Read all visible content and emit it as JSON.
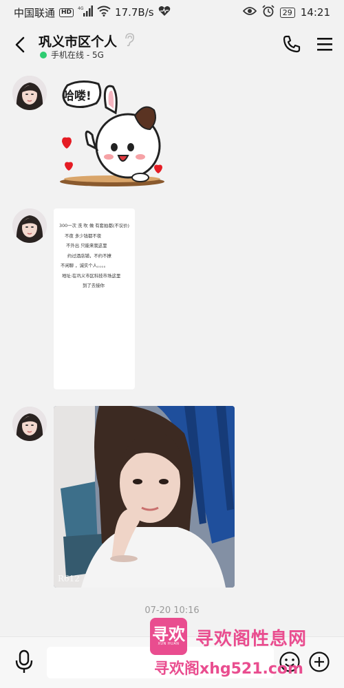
{
  "status_bar": {
    "carrier": "中国联通",
    "hd_badge": "HD",
    "network_type": "4G",
    "speed": "17.7B/s",
    "battery": "29",
    "time": "14:21"
  },
  "header": {
    "title": "巩义市区个人",
    "status": "手机在线 - 5G"
  },
  "messages": {
    "sticker_text": "哈喽!",
    "note_lines": [
      "300一次  洗  吹  做   有套拍都(不议价)",
      "不夜       多少钱都不夜",
      "不外出      只能来我这里",
      "约过酒店铺，不约不撩",
      "不闲聊  ，诚实个人。。。。",
      "地址:在巩义市区科技市场这里",
      "到了去接你"
    ],
    "photo_mark": "R612",
    "timestamp": "07-20 10:16"
  },
  "watermark": {
    "logo_char": "寻欢",
    "logo_sub": "XUN HUAN",
    "name": "寻欢阁性息网",
    "url": "寻欢阁xhg521.com"
  },
  "colors": {
    "background": "#f2f2f2",
    "online": "#2ecc71",
    "watermark": "#e94d8f"
  }
}
